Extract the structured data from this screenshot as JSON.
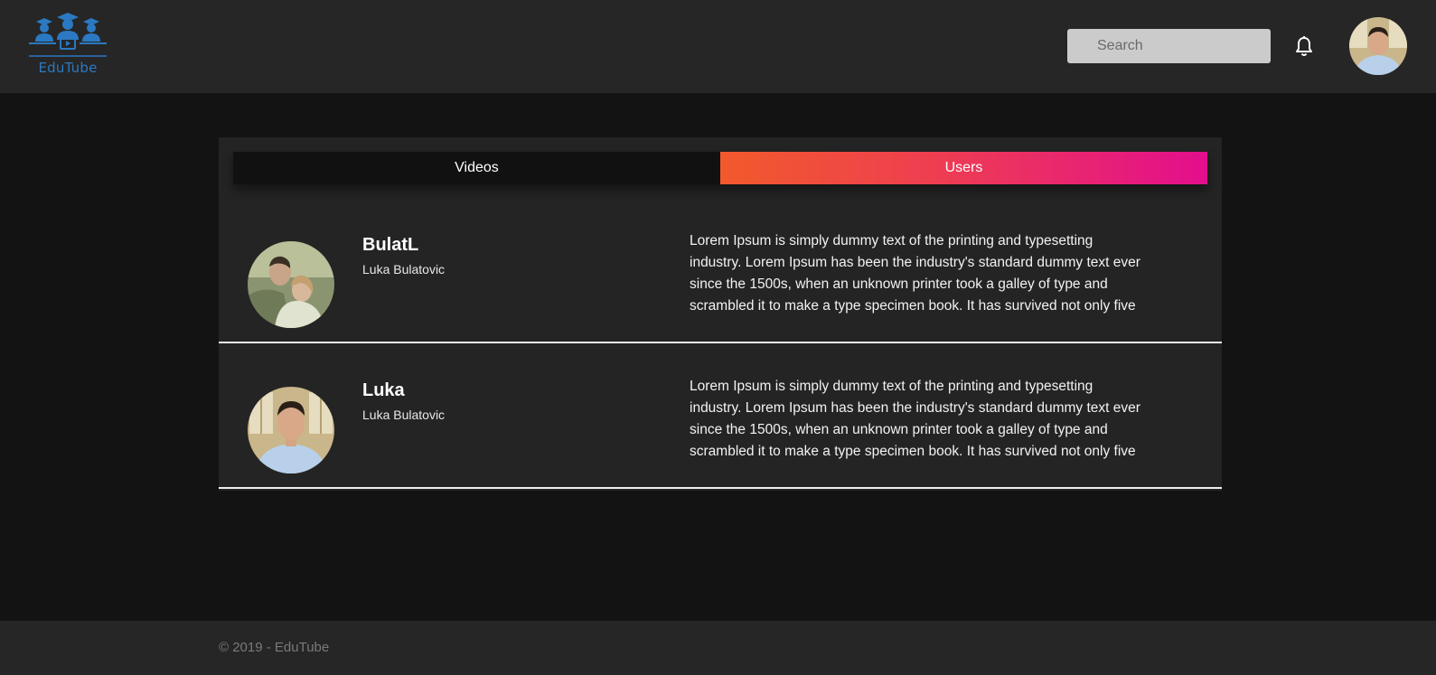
{
  "app": {
    "name": "EduTube"
  },
  "header": {
    "search_placeholder": "Search"
  },
  "tabs": [
    {
      "label": "Videos",
      "active": false
    },
    {
      "label": "Users",
      "active": true
    }
  ],
  "users": [
    {
      "username": "BulatL",
      "full_name": "Luka Bulatovic",
      "bio": "Lorem Ipsum is simply dummy text of the printing and typesetting industry. Lorem Ipsum has been the industry's standard dummy text ever since the 1500s, when an unknown printer took a galley of type and scrambled it to make a type specimen book. It has survived not only five"
    },
    {
      "username": "Luka",
      "full_name": "Luka Bulatovic",
      "bio": "Lorem Ipsum is simply dummy text of the printing and typesetting industry. Lorem Ipsum has been the industry's standard dummy text ever since the 1500s, when an unknown printer took a galley of type and scrambled it to make a type specimen book. It has survived not only five"
    }
  ],
  "footer": {
    "copyright": "© 2019 - EduTube"
  },
  "colors": {
    "background": "#131313",
    "header": "#262626",
    "card": "#242424",
    "logo_blue": "#2b79c2",
    "tab_gradient_start": "#f25a2c",
    "tab_gradient_end": "#e30e8d"
  },
  "icons": {
    "logo": "students-graduation-cap-logo",
    "notifications": "bell-icon"
  }
}
